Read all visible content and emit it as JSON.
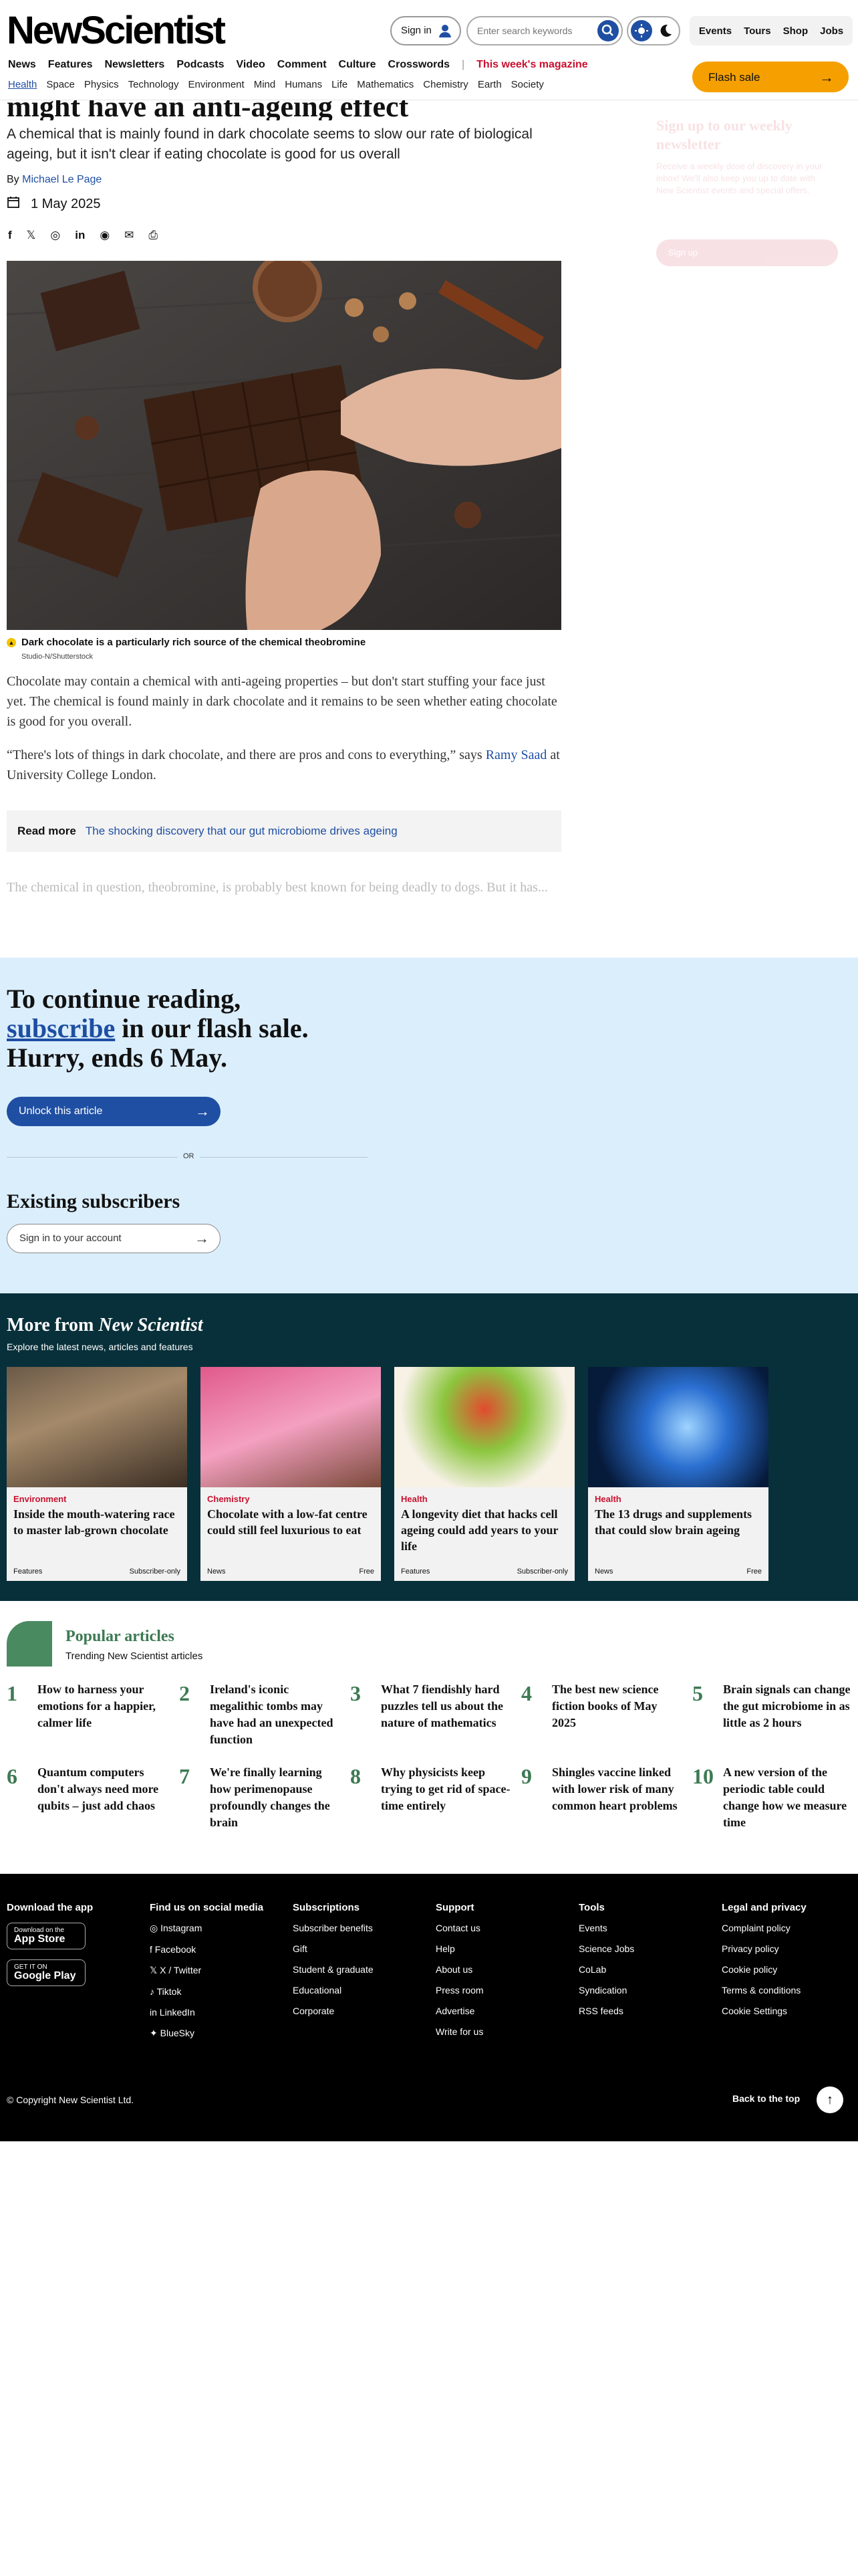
{
  "header": {
    "logo": "NewScientist",
    "sign_in": "Sign in",
    "search_placeholder": "Enter search keywords",
    "top_links": [
      "Events",
      "Tours",
      "Shop",
      "Jobs"
    ],
    "nav_primary": [
      "News",
      "Features",
      "Newsletters",
      "Podcasts",
      "Video",
      "Comment",
      "Culture",
      "Crosswords"
    ],
    "magazine_link": "This week's magazine",
    "nav_secondary": [
      "Health",
      "Space",
      "Physics",
      "Technology",
      "Environment",
      "Mind",
      "Humans",
      "Life",
      "Mathematics",
      "Chemistry",
      "Earth",
      "Society"
    ],
    "flash_sale": "Flash sale"
  },
  "article": {
    "headline": "might have an anti-ageing effect",
    "deck": "A chemical that is mainly found in dark chocolate seems to slow our rate of biological ageing, but it isn't clear if eating chocolate is good for us overall",
    "byline_prefix": "By ",
    "author": "Michael Le Page",
    "date": "1 May 2025",
    "caption": "Dark chocolate is a particularly rich source of the chemical theobromine",
    "credit": "Studio-N/Shutterstock",
    "para1": "Chocolate may contain a chemical with anti-ageing properties – but don't start stuffing your face just yet. The chemical is found mainly in dark chocolate and it remains to be seen whether eating chocolate is good for you overall.",
    "para2_before": "“There's lots of things in dark chocolate, and there are pros and cons to everything,” says ",
    "para2_link": "Ramy Saad",
    "para2_after": " at University College London.",
    "read_more_label": "Read more",
    "read_more_link": "The shocking discovery that our gut microbiome drives ageing",
    "faded_text": "The chemical in question, theobromine, is probably best known for being deadly to dogs. But it has..."
  },
  "sidebar": {
    "heading": "Sign up to our weekly newsletter",
    "text": "Receive a weekly dose of discovery in your inbox! We'll also keep you up to date with New Scientist events and special offers.",
    "button": "Sign up"
  },
  "paywall": {
    "line1": "To continue reading,",
    "subscribe": "subscribe",
    "line2_rest": " in our flash sale.",
    "line3": "Hurry, ends 6 May.",
    "unlock": "Unlock this article",
    "or": "OR",
    "existing": "Existing subscribers",
    "sign_in_account": "Sign in to your account"
  },
  "more": {
    "title_prefix": "More from ",
    "title_brand": "New Scientist",
    "subtitle": "Explore the latest news, articles and features",
    "cards": [
      {
        "category": "Environment",
        "title": "Inside the mouth-watering race to master lab-grown chocolate",
        "type": "Features",
        "access": "Subscriber-only"
      },
      {
        "category": "Chemistry",
        "title": "Chocolate with a low-fat centre could still feel luxurious to eat",
        "type": "News",
        "access": "Free"
      },
      {
        "category": "Health",
        "title": "A longevity diet that hacks cell ageing could add years to your life",
        "type": "Features",
        "access": "Subscriber-only"
      },
      {
        "category": "Health",
        "title": "The 13 drugs and supplements that could slow brain ageing",
        "type": "News",
        "access": "Free"
      }
    ]
  },
  "popular": {
    "title": "Popular articles",
    "subtitle": "Trending New Scientist articles",
    "items": [
      {
        "n": "1",
        "title": "How to harness your emotions for a happier, calmer life"
      },
      {
        "n": "2",
        "title": "Ireland's iconic megalithic tombs may have had an unexpected function"
      },
      {
        "n": "3",
        "title": "What 7 fiendishly hard puzzles tell us about the nature of mathematics"
      },
      {
        "n": "4",
        "title": "The best new science fiction books of May 2025"
      },
      {
        "n": "5",
        "title": "Brain signals can change the gut microbiome in as little as 2 hours"
      },
      {
        "n": "6",
        "title": "Quantum computers don't always need more qubits – just add chaos"
      },
      {
        "n": "7",
        "title": "We're finally learning how perimenopause profoundly changes the brain"
      },
      {
        "n": "8",
        "title": "Why physicists keep trying to get rid of space-time entirely"
      },
      {
        "n": "9",
        "title": "Shingles vaccine linked with lower risk of many common heart problems"
      },
      {
        "n": "10",
        "title": "A new version of the periodic table could change how we measure time"
      }
    ]
  },
  "footer": {
    "app_heading": "Download the app",
    "app_store_small": "Download on the",
    "app_store": "App Store",
    "google_small": "GET IT ON",
    "google": "Google Play",
    "social_heading": "Find us on social media",
    "social": [
      "Instagram",
      "Facebook",
      "X / Twitter",
      "Tiktok",
      "LinkedIn",
      "BlueSky"
    ],
    "subs_heading": "Subscriptions",
    "subs": [
      "Subscriber benefits",
      "Gift",
      "Student & graduate",
      "Educational",
      "Corporate"
    ],
    "support_heading": "Support",
    "support": [
      "Contact us",
      "Help",
      "About us",
      "Press room",
      "Advertise",
      "Write for us"
    ],
    "tools_heading": "Tools",
    "tools": [
      "Events",
      "Science Jobs",
      "CoLab",
      "Syndication",
      "RSS feeds"
    ],
    "legal_heading": "Legal and privacy",
    "legal": [
      "Complaint policy",
      "Privacy policy",
      "Cookie policy",
      "Terms & conditions",
      "Cookie Settings"
    ],
    "copyright": "© Copyright New Scientist Ltd.",
    "back_to_top": "Back to the top"
  },
  "colors": {
    "brand_blue": "#1f4fa3",
    "flash": "#f5a000",
    "popular_green": "#3d7a53",
    "more_bg": "#08303a",
    "paywall_bg": "#dbeefc"
  }
}
